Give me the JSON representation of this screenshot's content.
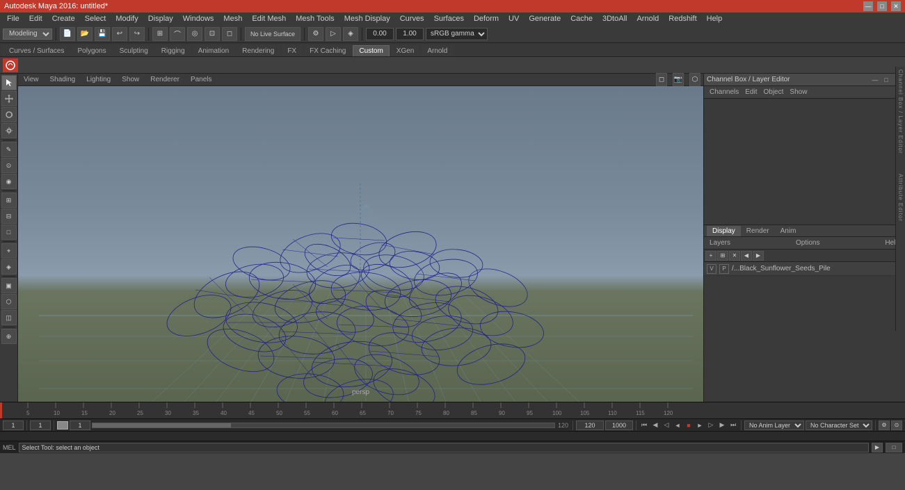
{
  "titlebar": {
    "title": "Autodesk Maya 2016: untitled*",
    "minimize": "—",
    "maximize": "□",
    "close": "✕"
  },
  "menubar": {
    "items": [
      "File",
      "Edit",
      "Create",
      "Select",
      "Modify",
      "Display",
      "Windows",
      "Mesh",
      "Edit Mesh",
      "Mesh Tools",
      "Mesh Display",
      "Curves",
      "Surfaces",
      "Deform",
      "UV",
      "Generate",
      "Cache",
      "3DtoAll",
      "Arnold",
      "Redshift",
      "Help"
    ]
  },
  "modebar": {
    "mode": "Modeling"
  },
  "shelftabs": {
    "tabs": [
      "Curves / Surfaces",
      "Polygons",
      "Sculpting",
      "Rigging",
      "Animation",
      "Rendering",
      "FX",
      "FX Caching",
      "Custom",
      "XGen",
      "Arnold"
    ],
    "active": "Custom"
  },
  "toolbar": {
    "no_live_surface": "No Live Surface",
    "value1": "0.00",
    "value2": "1.00",
    "colorspace": "sRGB gamma"
  },
  "viewport": {
    "label": "persp",
    "menus": [
      "View",
      "Shading",
      "Lighting",
      "Show",
      "Renderer",
      "Panels"
    ]
  },
  "rightpanel": {
    "title": "Channel Box / Layer Editor",
    "tabs": [
      "Channels",
      "Edit",
      "Object",
      "Show"
    ],
    "bottom_tabs": [
      "Display",
      "Render",
      "Anim"
    ],
    "layer_tabs": [
      "Layers",
      "Options",
      "Help"
    ],
    "layer": {
      "v": "V",
      "p": "P",
      "name": "/...Black_Sunflower_Seeds_Pile"
    },
    "attr_labels": [
      "Channel Box / Layer Editor",
      "Attribute Editor"
    ]
  },
  "timeline": {
    "start": "1",
    "end": "120",
    "ticks": [
      "5",
      "10",
      "15",
      "20",
      "25",
      "30",
      "35",
      "40",
      "45",
      "50",
      "55",
      "60",
      "65",
      "70",
      "75",
      "80",
      "85",
      "90",
      "95",
      "100",
      "105",
      "110",
      "115",
      "120"
    ]
  },
  "bottombar": {
    "frame_start": "1",
    "frame_end": "1",
    "playbar_label": "120",
    "anim_end": "120",
    "anim_end2": "1000",
    "no_anim_layer": "No Anim Layer",
    "no_char_set": "No Character Set"
  },
  "melbar": {
    "label": "MEL",
    "status": "Select Tool: select an object"
  },
  "lefttoolbar": {
    "tools": [
      "▷",
      "⟳",
      "↕",
      "✎",
      "⊕",
      "●",
      "◎",
      "□",
      "◈",
      "⚙",
      "▤",
      "▥",
      "⊞",
      "⊟",
      "≡",
      "≣"
    ]
  }
}
